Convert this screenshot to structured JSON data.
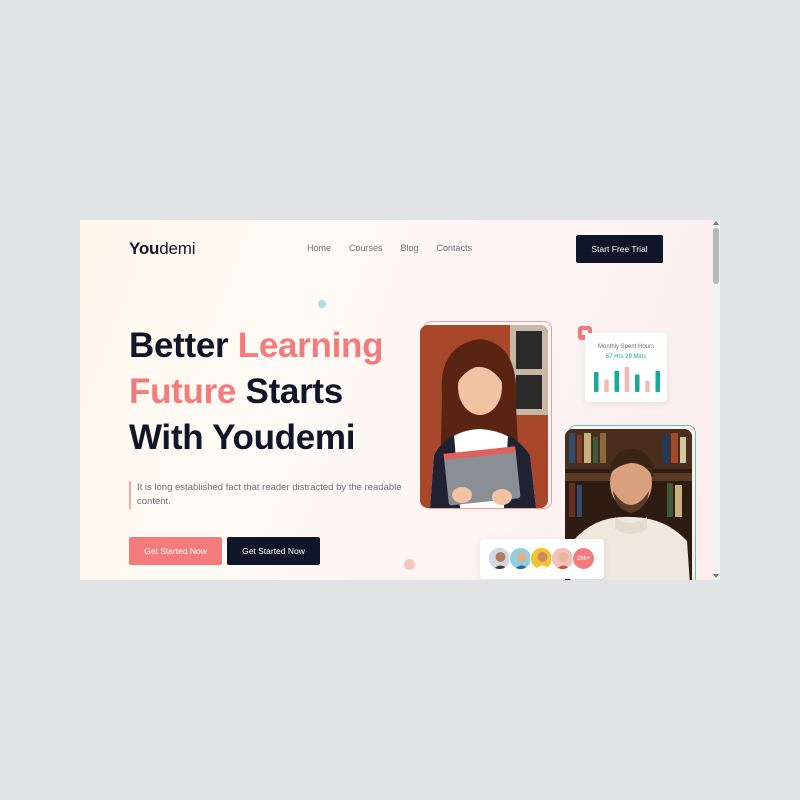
{
  "brand": {
    "logo_bold": "You",
    "logo_rest": "demi"
  },
  "nav": {
    "items": [
      "Home",
      "Courses",
      "Blog",
      "Contacts"
    ]
  },
  "header": {
    "cta_label": "Start Free Trial"
  },
  "hero": {
    "line1_a": "Better ",
    "line1_b": "Learning",
    "line2_a": "Future",
    "line2_b": " Starts",
    "line3": "With Youdemi",
    "description": "It is long established fact that reader distracted by the readable content.",
    "primary_button": "Get Started Now",
    "secondary_button": "Get Started Now"
  },
  "stats": {
    "title": "Monthly Spent Hours",
    "value": "67 Hrs 29 Mins",
    "bar_levels": [
      0.8,
      0.5,
      0.85,
      1.0,
      0.7,
      0.45,
      0.85
    ]
  },
  "avatars": {
    "count_label": "28k+"
  },
  "colors": {
    "accent": "#f47b7b",
    "dark": "#0f1628",
    "teal": "#17a99a"
  }
}
